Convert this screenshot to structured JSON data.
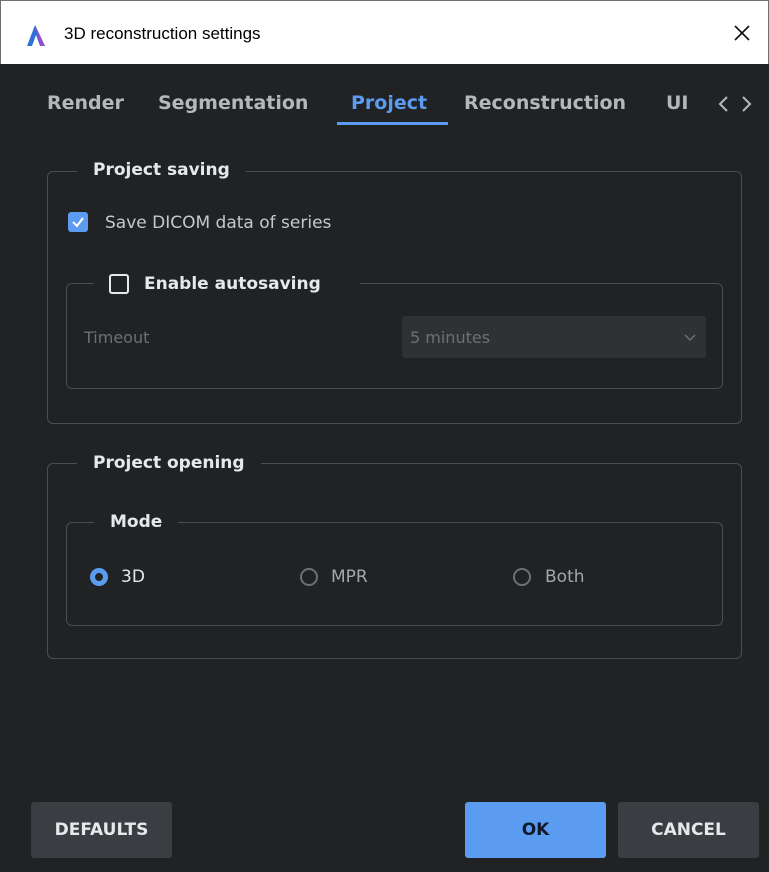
{
  "window": {
    "title": "3D reconstruction settings"
  },
  "tabs": [
    {
      "label": "Render",
      "active": false
    },
    {
      "label": "Segmentation",
      "active": false
    },
    {
      "label": "Project",
      "active": true
    },
    {
      "label": "Reconstruction",
      "active": false
    },
    {
      "label": "UI",
      "active": false
    }
  ],
  "project_saving": {
    "title": "Project saving",
    "save_dicom": {
      "label": "Save DICOM data of series",
      "checked": true
    },
    "autosaving": {
      "label": "Enable autosaving",
      "checked": false,
      "timeout_label": "Timeout",
      "timeout_value": "5 minutes"
    }
  },
  "project_opening": {
    "title": "Project opening",
    "mode": {
      "title": "Mode",
      "options": [
        {
          "label": "3D",
          "selected": true
        },
        {
          "label": "MPR",
          "selected": false
        },
        {
          "label": "Both",
          "selected": false
        }
      ]
    }
  },
  "buttons": {
    "defaults": "DEFAULTS",
    "ok": "OK",
    "cancel": "CANCEL"
  },
  "colors": {
    "accent": "#5b9cf0",
    "background": "#202224",
    "border": "#4a4d52",
    "disabled_text": "#6c7075"
  },
  "icons": {
    "app": "app-logo-icon",
    "close": "close-icon",
    "tab_prev": "chevron-left-icon",
    "tab_next": "chevron-right-icon",
    "check": "checkmark-icon",
    "dropdown": "chevron-down-icon"
  }
}
